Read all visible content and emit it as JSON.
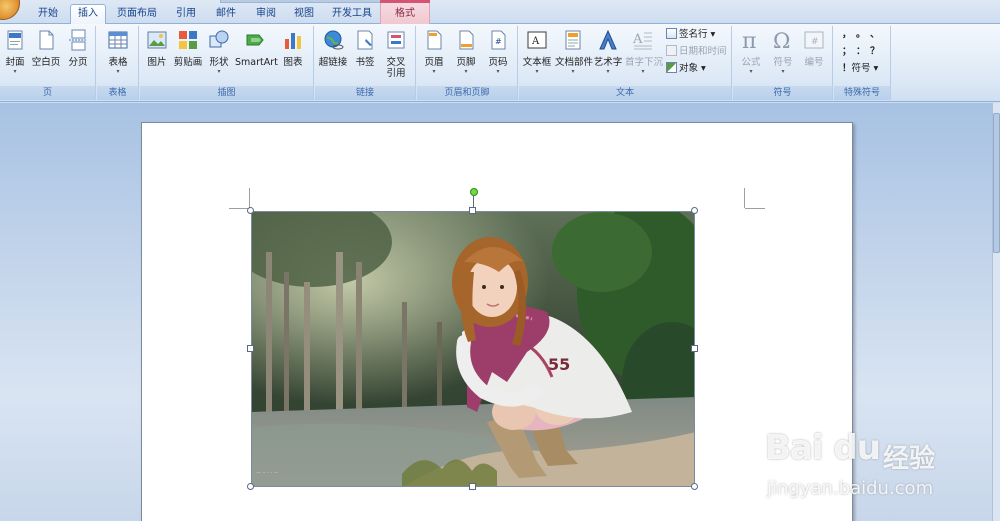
{
  "tabs": [
    {
      "label": "开始"
    },
    {
      "label": "插入",
      "active": true
    },
    {
      "label": "页面布局"
    },
    {
      "label": "引用"
    },
    {
      "label": "邮件"
    },
    {
      "label": "审阅"
    },
    {
      "label": "视图"
    },
    {
      "label": "开发工具"
    },
    {
      "label": "格式",
      "contextual": true
    }
  ],
  "groups": {
    "page": {
      "label": "页",
      "buttons": [
        "封面",
        "空白页",
        "分页"
      ]
    },
    "table": {
      "label": "表格",
      "buttons": [
        "表格"
      ]
    },
    "illustrations": {
      "label": "插图",
      "buttons": [
        "图片",
        "剪贴画",
        "形状",
        "SmartArt",
        "图表"
      ]
    },
    "links": {
      "label": "链接",
      "buttons": [
        "超链接",
        "书签",
        "交叉\n引用"
      ]
    },
    "header_footer": {
      "label": "页眉和页脚",
      "buttons": [
        "页眉",
        "页脚",
        "页码"
      ]
    },
    "text": {
      "label": "文本",
      "buttons": [
        "文本框",
        "文档部件",
        "艺术字",
        "首字下沉"
      ],
      "small": [
        "签名行",
        "日期和时间",
        "对象"
      ]
    },
    "symbols": {
      "label": "符号",
      "buttons": [
        "公式",
        "符号",
        "编号"
      ]
    },
    "special_symbols": {
      "label": "特殊符号",
      "chars": [
        "，",
        "。",
        "、",
        "；",
        "：",
        "？",
        "！"
      ],
      "button": "符号"
    }
  },
  "photo": {
    "photo_watermark_text": "··· ·· · · ···"
  },
  "watermark": {
    "brand": "Bai du",
    "cn": "经验",
    "url": "jingyan.baidu.com"
  },
  "colors": {
    "accent": "#15428b",
    "ribbon_label": "#3e6aaa",
    "rotate_handle": "#6ddc3e",
    "format_tab": "#d35473"
  }
}
